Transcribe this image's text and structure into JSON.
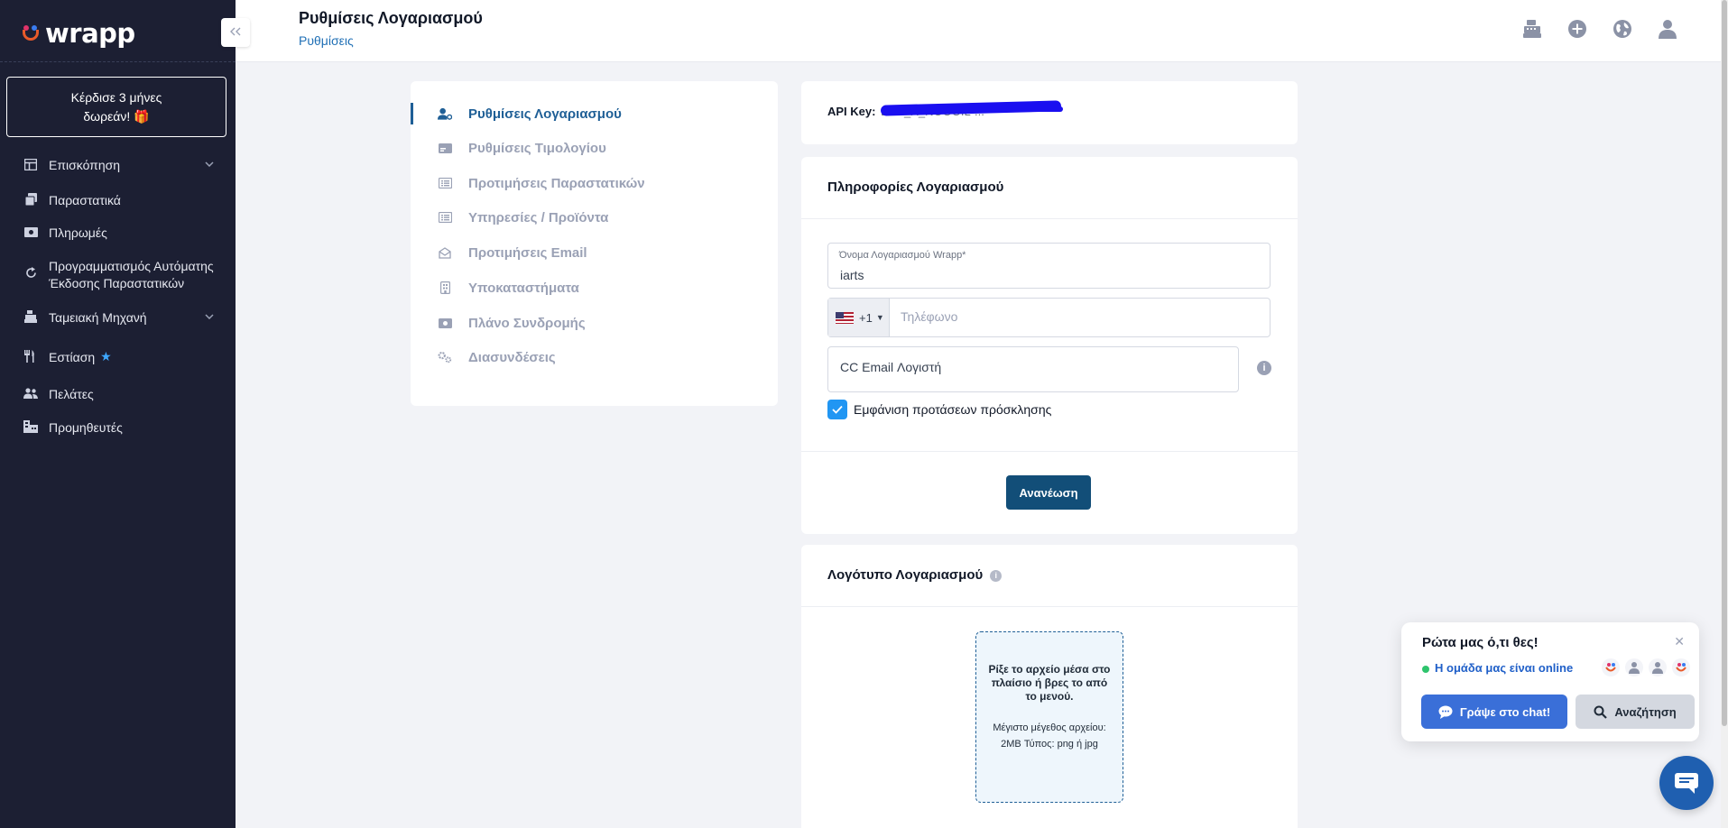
{
  "app": {
    "brand": "wrapp"
  },
  "sidebar": {
    "promo_line1": "Κέρδισε 3 μήνες",
    "promo_line2": "δωρεάν!",
    "items": [
      {
        "label": "Επισκόπηση",
        "icon": "layout-icon",
        "has_children": true
      },
      {
        "label": "Παραστατικά",
        "icon": "documents-icon"
      },
      {
        "label": "Πληρωμές",
        "icon": "cash-icon"
      },
      {
        "label": "Προγραμματισμός Αυτόματης Έκδοσης Παραστατικών",
        "icon": "recurring-icon"
      },
      {
        "label": "Ταμειακή Μηχανή",
        "icon": "cash-register-icon",
        "has_children": true
      },
      {
        "label": "Εστίαση",
        "icon": "utensils-icon",
        "badge_icon": "star-icon"
      },
      {
        "label": "Πελάτες",
        "icon": "users-icon"
      },
      {
        "label": "Προμηθευτές",
        "icon": "suppliers-icon"
      }
    ]
  },
  "header": {
    "title": "Ρυθμίσεις Λογαριασμού",
    "breadcrumb": "Ρυθμίσεις",
    "icons": [
      "cash-register-icon",
      "plus-circle-icon",
      "globe-icon",
      "user-icon"
    ]
  },
  "settings_menu": {
    "items": [
      {
        "label": "Ρυθμίσεις Λογαριασμού",
        "active": true,
        "icon": "user-cog-icon"
      },
      {
        "label": "Ρυθμίσεις Τιμολογίου",
        "icon": "invoice-card-icon"
      },
      {
        "label": "Προτιμήσεις Παραστατικών",
        "icon": "list-icon"
      },
      {
        "label": "Υπηρεσίες / Προϊόντα",
        "icon": "list-icon"
      },
      {
        "label": "Προτιμήσεις Email",
        "icon": "envelope-open-icon"
      },
      {
        "label": "Υποκαταστήματα",
        "icon": "building-icon"
      },
      {
        "label": "Πλάνο Συνδρομής",
        "icon": "money-icon"
      },
      {
        "label": "Διασυνδέσεις",
        "icon": "cogs-icon"
      }
    ]
  },
  "api_card": {
    "label": "API Key:",
    "value": "DTP_X_NOOOIL-..."
  },
  "account_info": {
    "heading": "Πληροφορίες Λογαριασμού",
    "account_name_label": "Όνομα Λογαριασμού Wrapp*",
    "account_name_value": "iarts",
    "phone_prefix": "+1",
    "phone_placeholder": "Τηλέφωνο",
    "cc_email_placeholder": "CC Email Λογιστή",
    "invite_checkbox_label": "Εμφάνιση προτάσεων πρόσκλησης",
    "invite_checked": true,
    "update_button": "Ανανέωση"
  },
  "logo_card": {
    "heading": "Λογότυπο Λογαριασμού",
    "dropzone_main": "Ρίξε το αρχείο μέσα στο πλαίσιο ή βρες το από το μενού.",
    "dropzone_sub": "Μέγιστο μέγεθος αρχείου: 2MB Τύπος: png ή jpg"
  },
  "chat": {
    "title": "Ρώτα μας ό,τι θες!",
    "online_text": "Η ομάδα μας είναι online",
    "primary_button": "Γράψε στο chat!",
    "secondary_button": "Αναζήτηση"
  }
}
